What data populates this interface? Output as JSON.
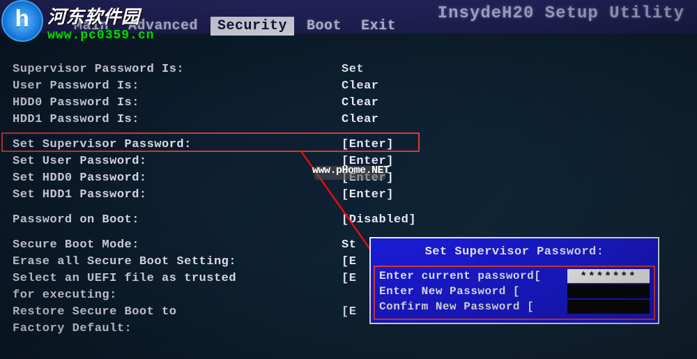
{
  "header": {
    "utility_title": "InsydeH20 Setup Utility",
    "tabs": [
      "Main",
      "Advanced",
      "Security",
      "Boot",
      "Exit"
    ],
    "active_tab": "Security"
  },
  "status_rows": [
    {
      "label": "Supervisor Password Is:",
      "value": "Set"
    },
    {
      "label": "User Password Is:",
      "value": "Clear"
    },
    {
      "label": "HDD0 Password Is:",
      "value": "Clear"
    },
    {
      "label": "HDD1 Password Is:",
      "value": "Clear"
    }
  ],
  "action_rows": [
    {
      "label": "Set Supervisor Password:",
      "value": "[Enter]",
      "highlighted": true
    },
    {
      "label": "Set User Password:",
      "value": "[Enter]"
    },
    {
      "label": "Set HDD0 Password:",
      "value": "[Enter]"
    },
    {
      "label": "Set HDD1 Password:",
      "value": "[Enter]"
    }
  ],
  "boot_row": {
    "label": "Password on Boot:",
    "value": "[Disabled]"
  },
  "secure_rows": [
    {
      "label": "Secure Boot Mode:",
      "value": "St"
    },
    {
      "label": "Erase all Secure Boot Setting:",
      "value": "[E"
    },
    {
      "label": "Select an UEFI file as trusted",
      "value": "[E"
    },
    {
      "label": "for executing:",
      "value": ""
    },
    {
      "label": "Restore Secure Boot to",
      "value": "[E"
    },
    {
      "label": "Factory Default:",
      "value": ""
    }
  ],
  "dialog": {
    "title": "Set Supervisor Password:",
    "rows": [
      {
        "label": "Enter current password[",
        "value": "*******",
        "field_class": "light"
      },
      {
        "label": "Enter New Password    [",
        "value": "",
        "field_class": "dark"
      },
      {
        "label": "Confirm New Password  [",
        "value": "",
        "field_class": "dark"
      }
    ]
  },
  "branding": {
    "logo_letter": "h",
    "logo_text": "河东软件园",
    "logo_url": "www.pc0359.cn"
  },
  "watermark": "www.pHome.NET"
}
